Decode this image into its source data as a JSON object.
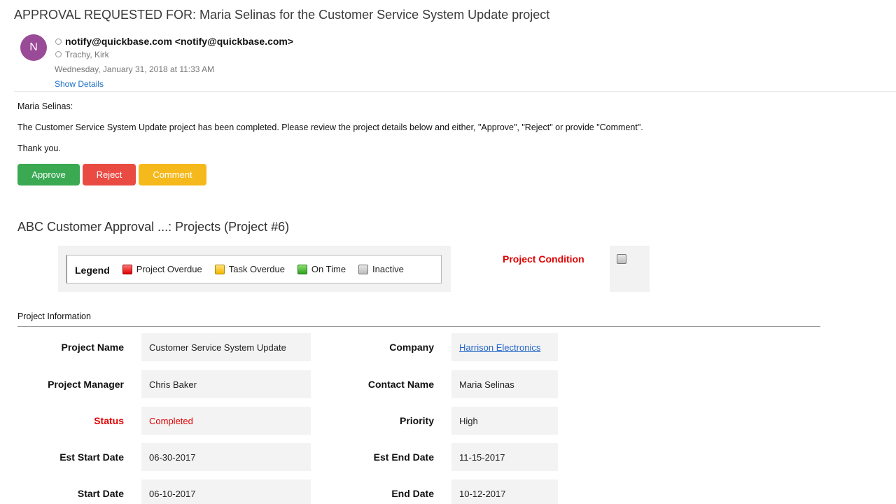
{
  "email": {
    "subject": "APPROVAL REQUESTED FOR: Maria Selinas for the Customer Service System Update project",
    "avatar_initial": "N",
    "from": "notify@quickbase.com <notify@quickbase.com>",
    "to": "Trachy, Kirk",
    "date": "Wednesday, January 31, 2018 at 11:33 AM",
    "show_details": "Show Details"
  },
  "body": {
    "greeting": "Maria Selinas:",
    "message": "The Customer Service System Update project has been completed.  Please review the project details below and either, \"Approve\", \"Reject\" or provide \"Comment\".",
    "closing": "Thank you."
  },
  "actions": {
    "approve": "Approve",
    "reject": "Reject",
    "comment": "Comment"
  },
  "app_title": "ABC Customer Approval ...: Projects (Project #6)",
  "legend": {
    "title": "Legend",
    "items": [
      "Project Overdue",
      "Task Overdue",
      "On Time",
      "Inactive"
    ]
  },
  "project_condition_label": "Project Condition",
  "section_title": "Project Information",
  "fields": {
    "project_name": {
      "label": "Project Name",
      "value": "Customer Service System Update"
    },
    "company": {
      "label": "Company",
      "value": "Harrison Electronics"
    },
    "project_manager": {
      "label": "Project Manager",
      "value": "Chris Baker"
    },
    "contact_name": {
      "label": "Contact Name",
      "value": "Maria Selinas"
    },
    "status": {
      "label": "Status",
      "value": "Completed"
    },
    "priority": {
      "label": "Priority",
      "value": "High"
    },
    "est_start_date": {
      "label": "Est Start Date",
      "value": "06-30-2017"
    },
    "est_end_date": {
      "label": "Est End Date",
      "value": "11-15-2017"
    },
    "start_date": {
      "label": "Start Date",
      "value": "06-10-2017"
    },
    "end_date": {
      "label": "End Date",
      "value": "10-12-2017"
    }
  },
  "colors": {
    "approve": "#3aa952",
    "reject": "#e94b43",
    "comment": "#f6b91c",
    "alert_red": "#e00000",
    "link_blue": "#2466c8"
  }
}
